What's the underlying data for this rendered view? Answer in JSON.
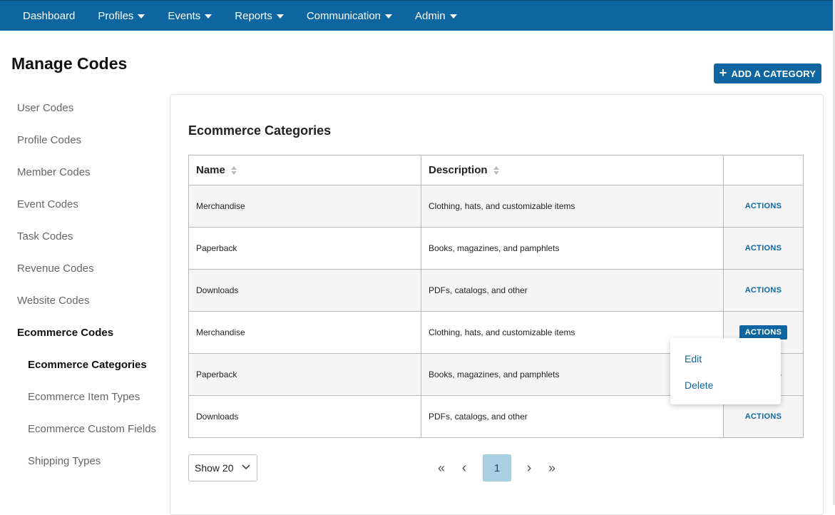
{
  "nav": {
    "items": [
      {
        "label": "Dashboard",
        "dropdown": false
      },
      {
        "label": "Profiles",
        "dropdown": true
      },
      {
        "label": "Events",
        "dropdown": true
      },
      {
        "label": "Reports",
        "dropdown": true
      },
      {
        "label": "Communication",
        "dropdown": true
      },
      {
        "label": "Admin",
        "dropdown": true
      }
    ],
    "bg_color": "#0e66a0"
  },
  "page": {
    "title": "Manage Codes",
    "add_button_label": "ADD A CATEGORY"
  },
  "sidebar": {
    "items": [
      {
        "label": "User Codes"
      },
      {
        "label": "Profile Codes"
      },
      {
        "label": "Member Codes"
      },
      {
        "label": "Event Codes"
      },
      {
        "label": "Task Codes"
      },
      {
        "label": "Revenue Codes"
      },
      {
        "label": "Website Codes"
      },
      {
        "label": "Ecommerce Codes"
      },
      {
        "label": "Ecommerce Categories"
      },
      {
        "label": "Ecommerce Item Types"
      },
      {
        "label": "Ecommerce Custom Fields"
      },
      {
        "label": "Shipping Types"
      }
    ]
  },
  "card": {
    "title": "Ecommerce Categories"
  },
  "table": {
    "headers": {
      "name": "Name",
      "description": "Description"
    },
    "action_label": "ACTIONS",
    "rows": [
      {
        "name": "Merchandise",
        "description": "Clothing, hats, and customizable items"
      },
      {
        "name": "Paperback",
        "description": "Books, magazines, and pamphlets"
      },
      {
        "name": "Downloads",
        "description": "PDFs, catalogs, and other"
      },
      {
        "name": "Merchandise",
        "description": "Clothing, hats, and customizable items"
      },
      {
        "name": "Paperback",
        "description": "Books, magazines, and pamphlets"
      },
      {
        "name": "Downloads",
        "description": "PDFs, catalogs, and other"
      }
    ]
  },
  "actions_menu": {
    "edit": "Edit",
    "delete": "Delete"
  },
  "pagination": {
    "page_size_label": "Show 20",
    "current_page": "1",
    "first_glyph": "«",
    "prev_glyph": "‹",
    "next_glyph": "›",
    "last_glyph": "»"
  }
}
